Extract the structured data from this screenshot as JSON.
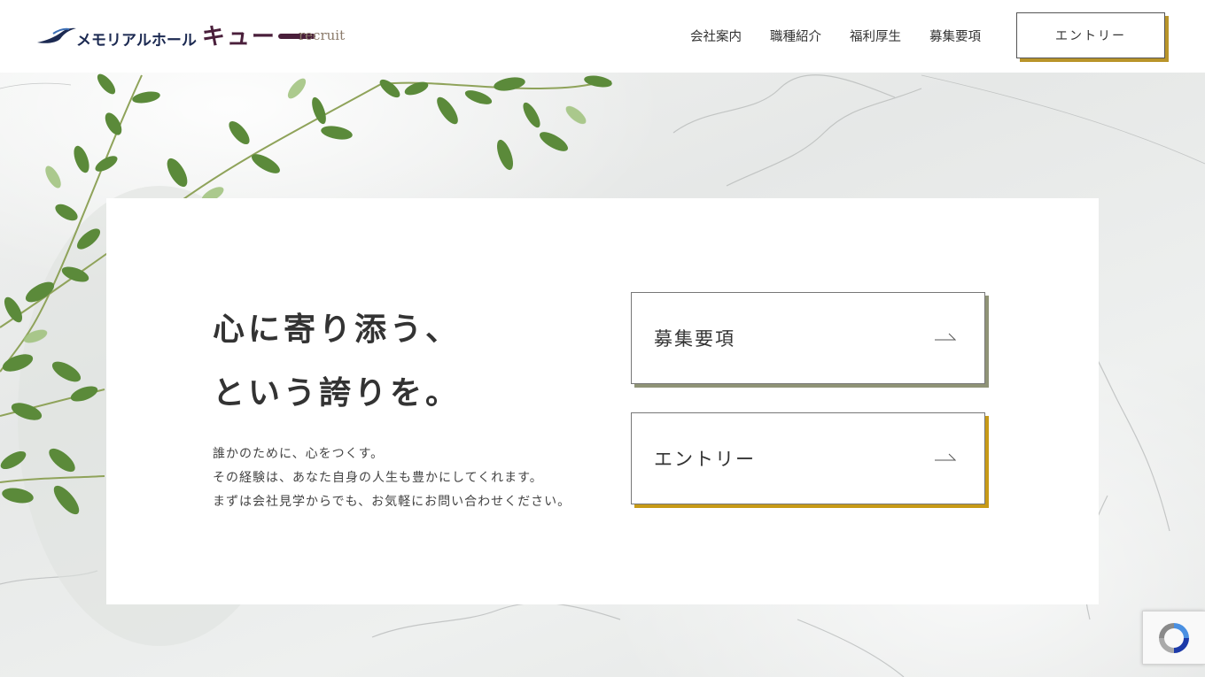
{
  "header": {
    "logo_text": "メモリアルホール",
    "logo_brand": "キュー",
    "tagline": "recruit",
    "nav": [
      {
        "label": "会社案内"
      },
      {
        "label": "職種紹介"
      },
      {
        "label": "福利厚生"
      },
      {
        "label": "募集要項"
      }
    ],
    "entry_button": "エントリー"
  },
  "hero": {
    "headline_line1": "心に寄り添う、",
    "headline_line2": "という誇りを。",
    "body_line1": "誰かのために、心をつくす。",
    "body_line2": "その経験は、あなた自身の人生も豊かにしてくれます。",
    "body_line3": "まずは会社見学からでも、お気軽にお問い合わせください。",
    "cta": [
      {
        "label": "募集要項",
        "accent": "#8f9377"
      },
      {
        "label": "エントリー",
        "accent": "#c79a17"
      }
    ]
  },
  "colors": {
    "brand_navy": "#1c2a52",
    "brand_plum": "#4a1f3b",
    "gold": "#c79a17",
    "olive": "#8f9377"
  },
  "icons": {
    "cta_arrow": "arrow-right-icon",
    "recaptcha": "recaptcha-icon"
  }
}
